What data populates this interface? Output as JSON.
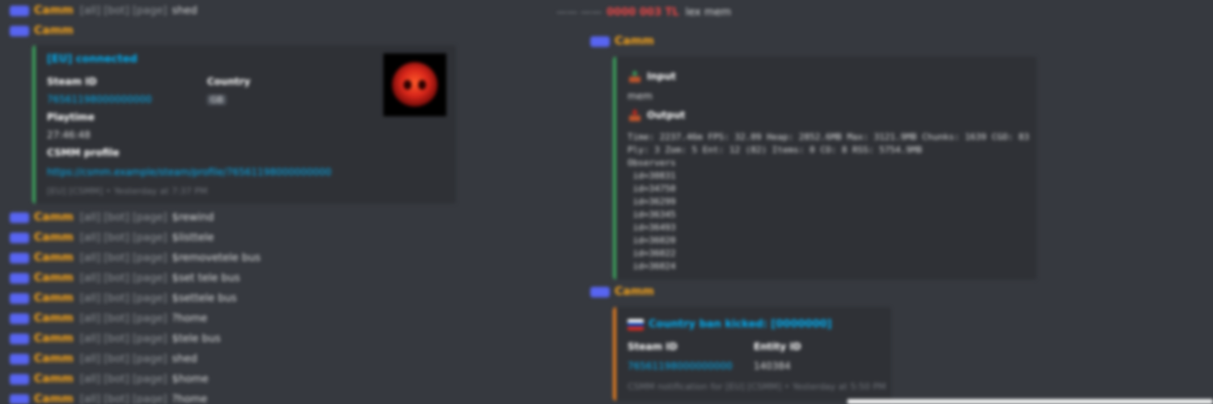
{
  "left": {
    "messages_top": [
      {
        "author": "Camm",
        "context": "[all] [bot] [page]",
        "text": "shed"
      },
      {
        "author": "Camm"
      }
    ],
    "embed": {
      "title": "[EU] connected",
      "fields": [
        {
          "name": "Steam ID",
          "value": "76561198000000000",
          "value_is_link": true
        },
        {
          "name": "Country",
          "value": "GB",
          "value_is_badge": true
        },
        {
          "name": "Playtime",
          "value": "27:46:48"
        },
        {
          "name": "CSMM profile",
          "value": "https://csmm.example/steam/profile/76561198000000000",
          "value_is_link": true
        }
      ],
      "footer": "[EU] [CSMM] • Yesterday at 7:37 PM"
    },
    "messages_bottom": [
      {
        "author": "Camm",
        "context": "[all] [bot] [page]",
        "text": "$rewind"
      },
      {
        "author": "Camm",
        "context": "[all] [bot] [page]",
        "text": "$listtele"
      },
      {
        "author": "Camm",
        "context": "[all] [bot] [page]",
        "text": "$removetele bus"
      },
      {
        "author": "Camm",
        "context": "[all] [bot] [page]",
        "text": "$set tele bus"
      },
      {
        "author": "Camm",
        "context": "[all] [bot] [page]",
        "text": "$settele bus"
      },
      {
        "author": "Camm",
        "context": "[all] [bot] [page]",
        "text": "?home"
      },
      {
        "author": "Camm",
        "context": "[all] [bot] [page]",
        "text": "$tele bus"
      },
      {
        "author": "Camm",
        "context": "[all] [bot] [page]",
        "text": "shed"
      },
      {
        "author": "Camm",
        "context": "[all] [bot] [page]",
        "text": "$home"
      },
      {
        "author": "Camm",
        "context": "[all] [bot] [page]",
        "text": "?home"
      }
    ]
  },
  "right": {
    "top_line": {
      "muted": "—— ——",
      "name": "0000 003 TL",
      "text": "lex mem"
    },
    "msg1": {
      "author": "Camm",
      "input_label": "Input",
      "input_value": "mem",
      "output_label": "Output",
      "output_lines": [
        "Time: 2237.46m FPS: 32.09 Heap: 2852.6MB Max: 3121.9MB Chunks: 1639 CGO: 83",
        "Ply: 3 Zom: 5 Ent: 12 (82) Items: 0 CO: 8 RSS: 5754.9MB",
        "Observers",
        " id=30831",
        " id=34750",
        " id=36299",
        " id=36345",
        " id=36493",
        " id=36020",
        " id=36022",
        " id=36024"
      ]
    },
    "msg2": {
      "author": "Camm",
      "title": "Country ban kicked: [0000000]",
      "fields": [
        {
          "name": "Steam ID",
          "value": "76561198000000000",
          "value_is_link": true
        },
        {
          "name": "Entity ID",
          "value": "140384"
        }
      ],
      "footer": "CSMM notification for [EU] [CSMM] • Yesterday at 5:50 PM"
    }
  },
  "colors": {
    "background": "#36393f",
    "embed_bg": "#2f3136",
    "author": "#faa61a",
    "link": "#00aff4",
    "green_bar": "#3ba55d",
    "orange_bar": "#e67e22"
  }
}
